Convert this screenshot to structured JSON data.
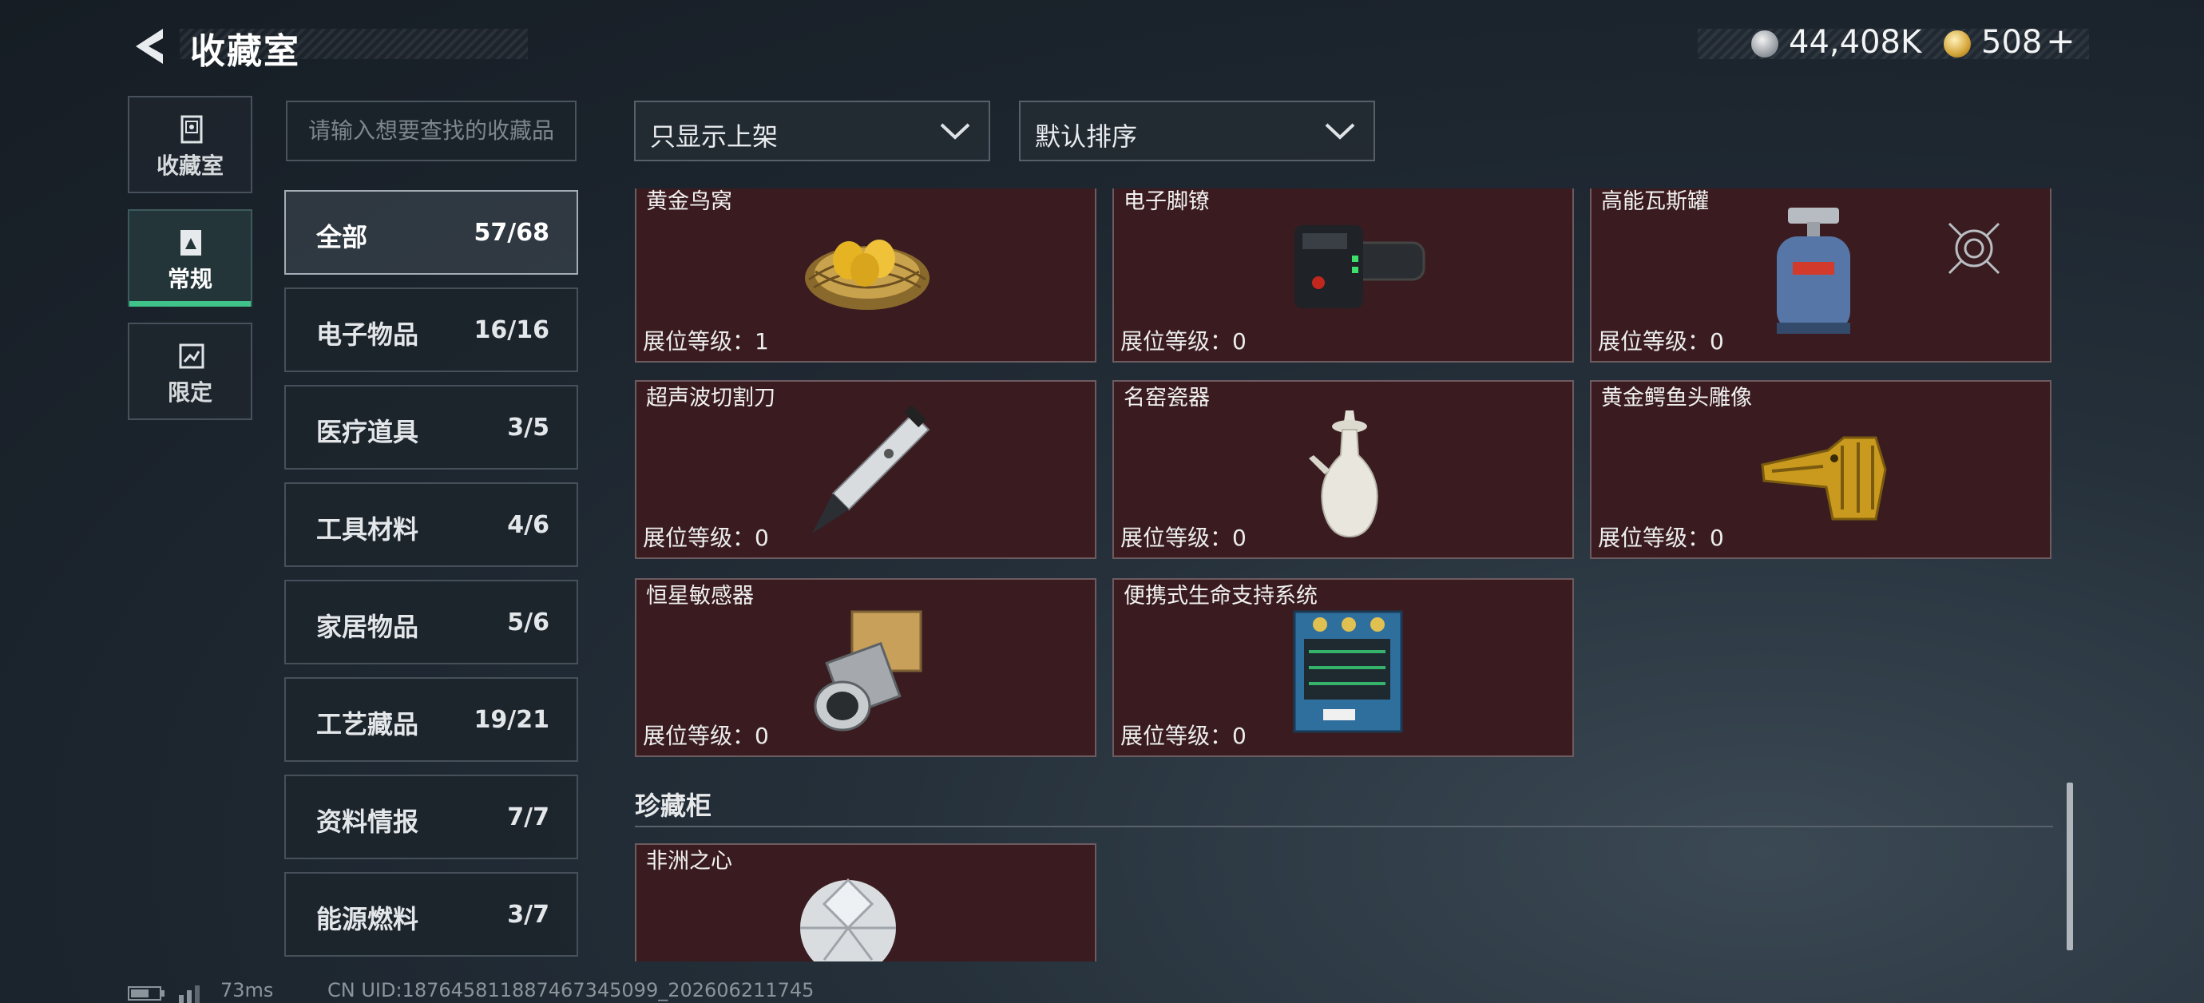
{
  "header": {
    "title": "收藏室",
    "back_icon": "chevron-left-icon"
  },
  "currency": {
    "silver": "44,408K",
    "gold": "508",
    "gold_add": "+"
  },
  "nav": [
    {
      "label": "收藏室",
      "icon": "collection-icon",
      "active": false
    },
    {
      "label": "常规",
      "icon": "regular-icon",
      "active": true
    },
    {
      "label": "限定",
      "icon": "limited-icon",
      "active": false
    }
  ],
  "search": {
    "placeholder": "请输入想要查找的收藏品"
  },
  "filters": {
    "shelf": "只显示上架",
    "sort": "默认排序"
  },
  "categories": [
    {
      "name": "全部",
      "count": "57/68"
    },
    {
      "name": "电子物品",
      "count": "16/16"
    },
    {
      "name": "医疗道具",
      "count": "3/5"
    },
    {
      "name": "工具材料",
      "count": "4/6"
    },
    {
      "name": "家居物品",
      "count": "5/6"
    },
    {
      "name": "工艺藏品",
      "count": "19/21"
    },
    {
      "name": "资料情报",
      "count": "7/7"
    },
    {
      "name": "能源燃料",
      "count": "3/7"
    }
  ],
  "items": [
    {
      "name": "黄金鸟窝",
      "level": "展位等级：1"
    },
    {
      "name": "电子脚镣",
      "level": "展位等级：0"
    },
    {
      "name": "高能瓦斯罐",
      "level": "展位等级：0"
    },
    {
      "name": "超声波切割刀",
      "level": "展位等级：0"
    },
    {
      "name": "名窑瓷器",
      "level": "展位等级：0"
    },
    {
      "name": "黄金鳄鱼头雕像",
      "level": "展位等级：0"
    },
    {
      "name": "恒星敏感器",
      "level": "展位等级：0"
    },
    {
      "name": "便携式生命支持系统",
      "level": "展位等级：0"
    }
  ],
  "treasure": {
    "title": "珍藏柜",
    "items": [
      {
        "name": "非洲之心"
      }
    ]
  },
  "footer": {
    "ping": "73ms",
    "uid": "CN UID:187645811887467345099_202606211745"
  }
}
